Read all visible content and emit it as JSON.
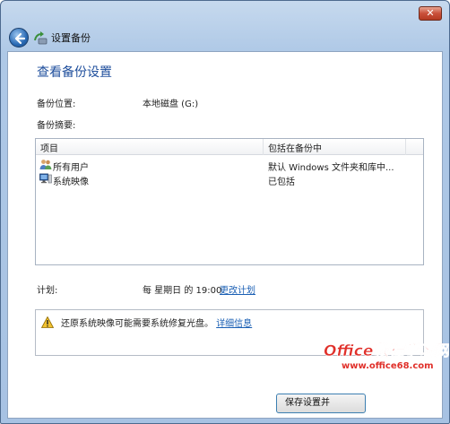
{
  "window": {
    "close_glyph": "✕",
    "title": "设置备份"
  },
  "page": {
    "heading": "查看备份设置",
    "location_label": "备份位置:",
    "location_value": "本地磁盘 (G:)",
    "summary_label": "备份摘要:"
  },
  "list": {
    "columns": [
      "项目",
      "包括在备份中"
    ],
    "rows": [
      {
        "name": "所有用户",
        "value": "默认 Windows 文件夹和库中...",
        "icon": "users-icon"
      },
      {
        "name": "系统映像",
        "value": "已包括",
        "icon": "computer-icon"
      }
    ]
  },
  "schedule": {
    "label": "计划:",
    "value": "每 星期日 的 19:00",
    "change_link": "更改计划"
  },
  "notice": {
    "text": "还原系统映像可能需要系统修复光盘。",
    "link": "详细信息"
  },
  "footer": {
    "save_button": "保存设置并"
  },
  "watermark": {
    "brand": "Office教程学习网",
    "url": "www.office68.com"
  },
  "colors": {
    "heading": "#1e4e9c",
    "link": "#1a5fb4",
    "close_button": "#c9503a"
  }
}
